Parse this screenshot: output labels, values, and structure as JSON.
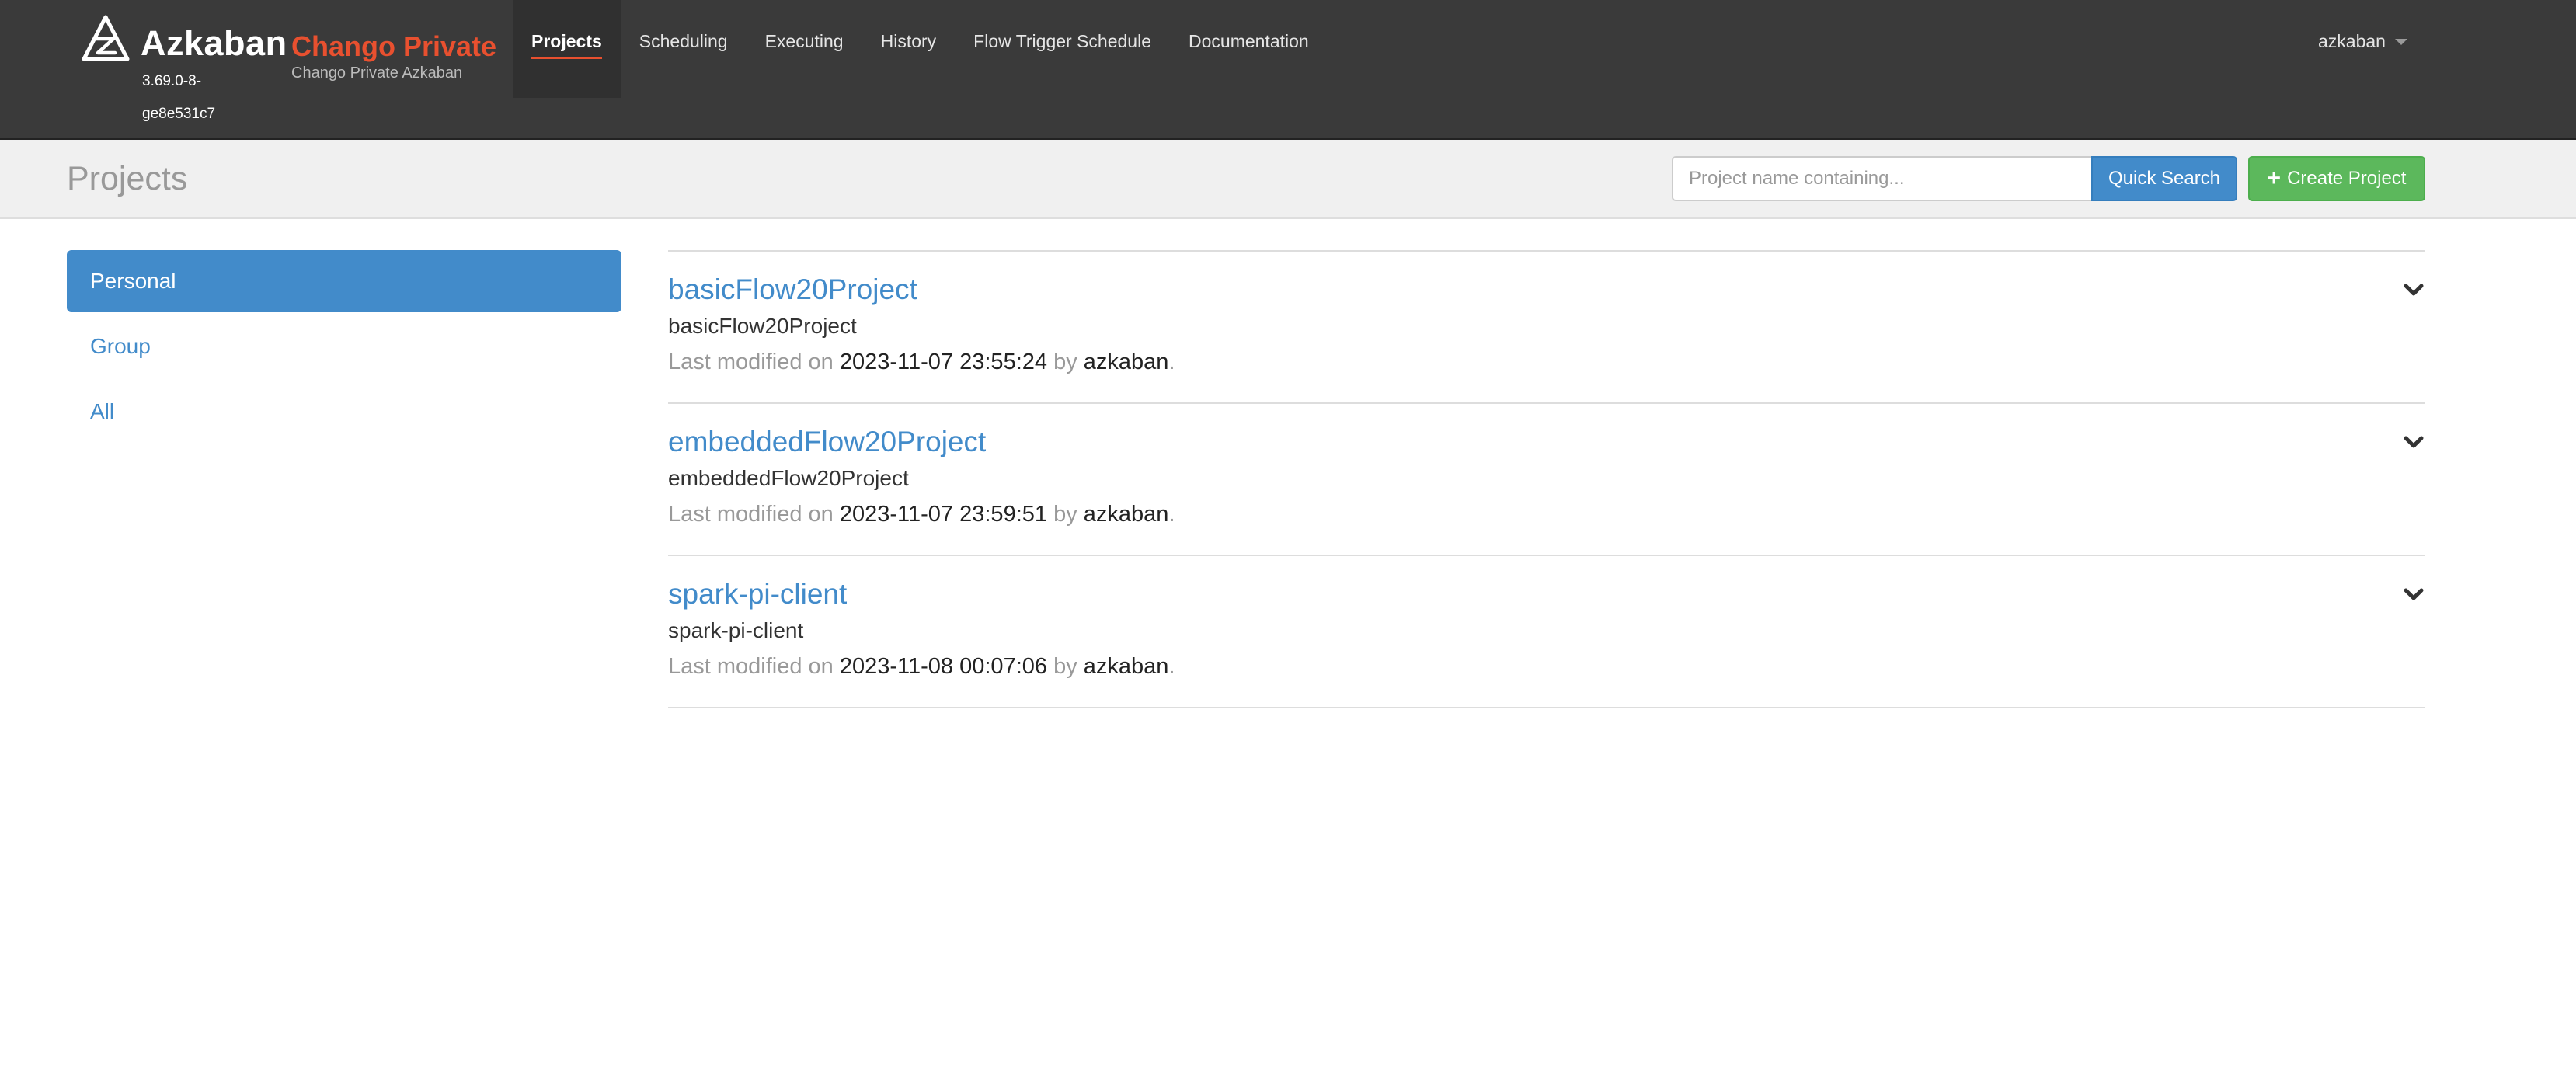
{
  "brand": {
    "name": "Azkaban",
    "version": "3.69.0-8-ge8e531c7",
    "sub_title": "Chango Private",
    "sub_desc": "Chango Private Azkaban"
  },
  "nav": {
    "items": [
      {
        "label": "Projects",
        "active": true
      },
      {
        "label": "Scheduling"
      },
      {
        "label": "Executing"
      },
      {
        "label": "History"
      },
      {
        "label": "Flow Trigger Schedule"
      },
      {
        "label": "Documentation"
      }
    ],
    "user": "azkaban"
  },
  "header": {
    "title": "Projects",
    "search_placeholder": "Project name containing...",
    "search_button": "Quick Search",
    "create_button": "Create Project"
  },
  "filters": [
    {
      "label": "Personal",
      "active": true
    },
    {
      "label": "Group"
    },
    {
      "label": "All"
    }
  ],
  "projects": [
    {
      "name": "basicFlow20Project",
      "description": "basicFlow20Project",
      "modified_prefix": "Last modified on",
      "modified": "2023-11-07 23:55:24",
      "by_label": "by",
      "user": "azkaban",
      "end": "."
    },
    {
      "name": "embeddedFlow20Project",
      "description": "embeddedFlow20Project",
      "modified_prefix": "Last modified on",
      "modified": "2023-11-07 23:59:51",
      "by_label": "by",
      "user": "azkaban",
      "end": "."
    },
    {
      "name": "spark-pi-client",
      "description": "spark-pi-client",
      "modified_prefix": "Last modified on",
      "modified": "2023-11-08 00:07:06",
      "by_label": "by",
      "user": "azkaban",
      "end": "."
    }
  ],
  "colors": {
    "navbar": "#3a3a3a",
    "accent": "#e8502f",
    "primary": "#428bca",
    "success": "#5cb85c"
  },
  "icons": {
    "logo": "azkaban-logo-icon",
    "caret": "caret-down-icon",
    "plus": "plus-icon",
    "expand": "chevron-down-icon"
  }
}
